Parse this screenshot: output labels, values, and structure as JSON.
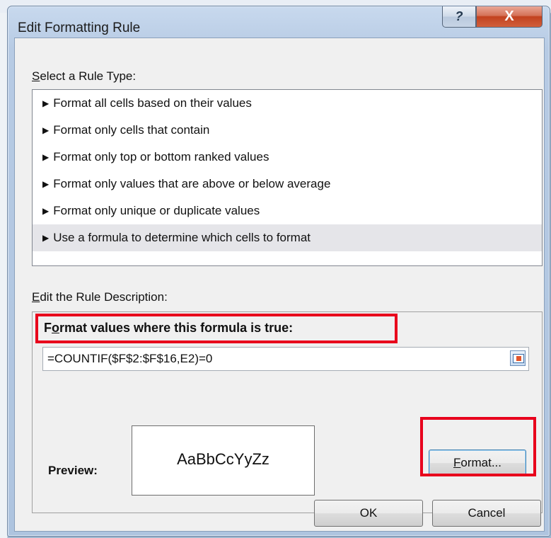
{
  "dialog": {
    "title": "Edit Formatting Rule",
    "help_glyph": "?",
    "close_glyph": "X"
  },
  "rule_type": {
    "label": "Select a Rule Type:",
    "items": [
      "Format all cells based on their values",
      "Format only cells that contain",
      "Format only top or bottom ranked values",
      "Format only values that are above or below average",
      "Format only unique or duplicate values",
      "Use a formula to determine which cells to format"
    ],
    "selected_index": 5
  },
  "description": {
    "label": "Edit the Rule Description:",
    "heading": "Format values where this formula is true:",
    "formula_value": "=COUNTIF($F$2:$F$16,E2)=0",
    "preview_label": "Preview:",
    "preview_sample": "AaBbCcYyZz",
    "format_button": "Format..."
  },
  "buttons": {
    "ok": "OK",
    "cancel": "Cancel"
  },
  "annotations": {
    "highlight_color": "#e8001c"
  },
  "icons": {
    "arrow": "right-triangle-icon",
    "range_select": "collapse-dialog-icon"
  }
}
